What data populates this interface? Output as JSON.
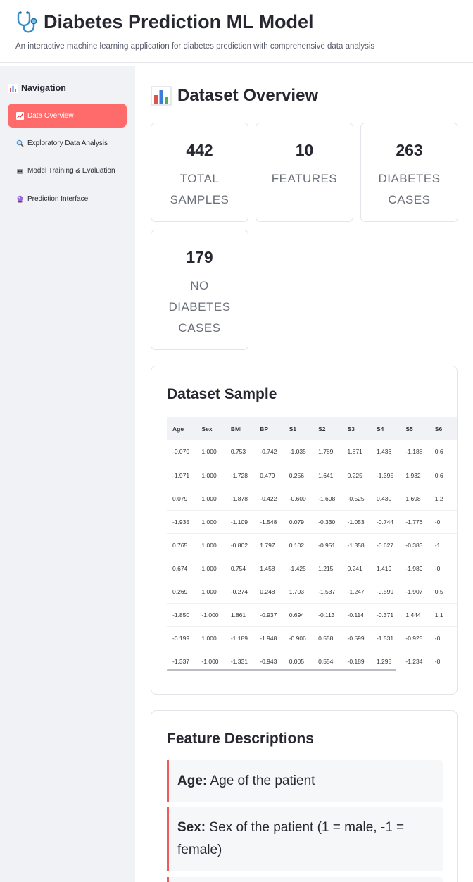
{
  "header": {
    "title": "Diabetes Prediction ML Model",
    "subtitle": "An interactive machine learning application for diabetes prediction with comprehensive data analysis",
    "icon": "stethoscope-icon"
  },
  "sidebar": {
    "title": "Navigation",
    "title_icon": "bar-chart-icon",
    "items": [
      {
        "label": "Data Overview",
        "icon": "trending-chart-icon",
        "active": true
      },
      {
        "label": "Exploratory Data Analysis",
        "icon": "magnifier-icon",
        "active": false
      },
      {
        "label": "Model Training & Evaluation",
        "icon": "robot-icon",
        "active": false
      },
      {
        "label": "Prediction Interface",
        "icon": "crystal-ball-icon",
        "active": false
      }
    ]
  },
  "main": {
    "title": "Dataset Overview",
    "title_icon": "bar-chart-icon",
    "metrics": [
      {
        "value": "442",
        "label": "Total Samples"
      },
      {
        "value": "10",
        "label": "Features"
      },
      {
        "value": "263",
        "label": "Diabetes Cases"
      },
      {
        "value": "179",
        "label": "No Diabetes Cases"
      }
    ],
    "sample": {
      "title": "Dataset Sample",
      "columns": [
        "Age",
        "Sex",
        "BMI",
        "BP",
        "S1",
        "S2",
        "S3",
        "S4",
        "S5",
        "S6"
      ],
      "rows": [
        [
          "-0.070",
          "1.000",
          "0.753",
          "-0.742",
          "-1.035",
          "1.789",
          "1.871",
          "1.436",
          "-1.188",
          "0.6"
        ],
        [
          "-1.971",
          "1.000",
          "-1.728",
          "0.479",
          "0.256",
          "1.641",
          "0.225",
          "-1.395",
          "1.932",
          "0.6"
        ],
        [
          "0.079",
          "1.000",
          "-1.878",
          "-0.422",
          "-0.600",
          "-1.608",
          "-0.525",
          "0.430",
          "1.698",
          "1.2"
        ],
        [
          "-1.935",
          "1.000",
          "-1.109",
          "-1.548",
          "0.079",
          "-0.330",
          "-1.053",
          "-0.744",
          "-1.776",
          "-0."
        ],
        [
          "0.765",
          "1.000",
          "-0.802",
          "1.797",
          "0.102",
          "-0.951",
          "-1.358",
          "-0.627",
          "-0.383",
          "-1."
        ],
        [
          "0.674",
          "1.000",
          "0.754",
          "1.458",
          "-1.425",
          "1.215",
          "0.241",
          "1.419",
          "-1.989",
          "-0."
        ],
        [
          "0.269",
          "1.000",
          "-0.274",
          "0.248",
          "1.703",
          "-1.537",
          "-1.247",
          "-0.599",
          "-1.907",
          "0.5"
        ],
        [
          "-1.850",
          "-1.000",
          "1.861",
          "-0.937",
          "0.694",
          "-0.113",
          "-0.114",
          "-0.371",
          "1.444",
          "1.1"
        ],
        [
          "-0.199",
          "1.000",
          "-1.189",
          "-1.948",
          "-0.906",
          "0.558",
          "-0.599",
          "-1.531",
          "-0.925",
          "-0."
        ],
        [
          "-1.337",
          "-1.000",
          "-1.331",
          "-0.943",
          "0.005",
          "0.554",
          "-0.189",
          "1.295",
          "-1.234",
          "-0."
        ]
      ]
    },
    "features": {
      "title": "Feature Descriptions",
      "items": [
        {
          "name": "Age:",
          "text": "Age of the patient"
        },
        {
          "name": "Sex:",
          "text": "Sex of the patient (1 = male, -1 = female)"
        }
      ]
    }
  },
  "colors": {
    "accent": "#ff6b6b",
    "sidebar_bg": "#f0f2f6",
    "desc_border": "#ef5a5a"
  }
}
